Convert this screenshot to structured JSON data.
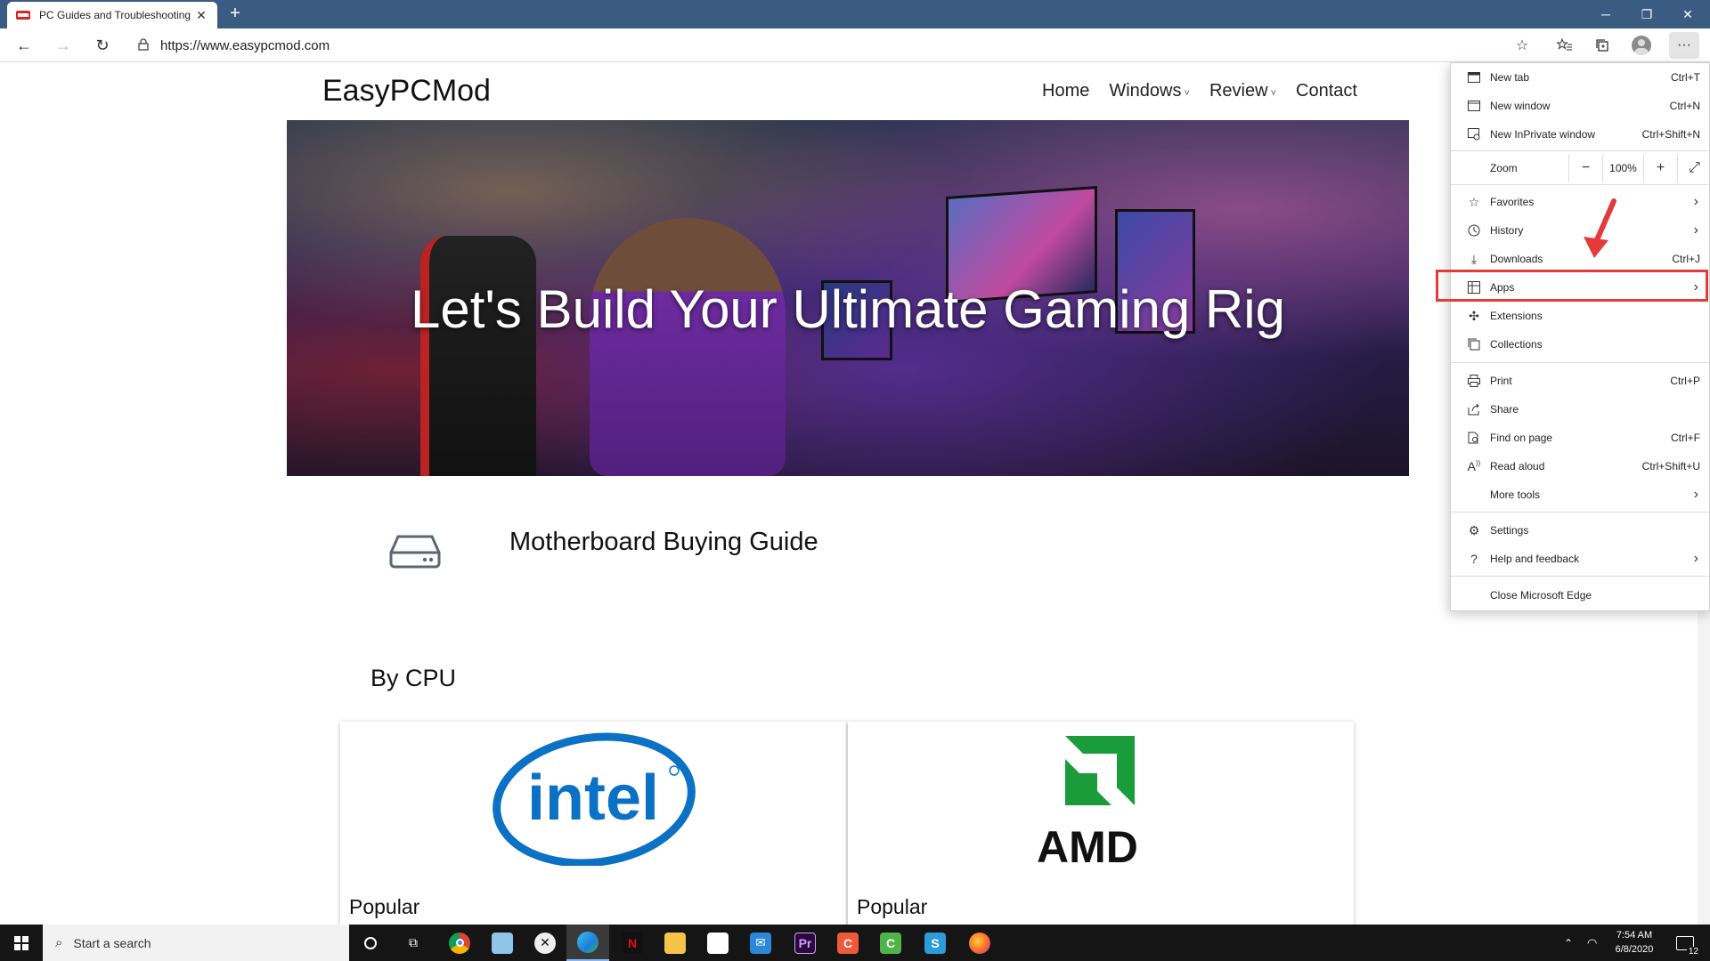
{
  "browser": {
    "tab_title": "PC Guides and Troubleshooting",
    "url": "https://www.easypcmod.com"
  },
  "site": {
    "brand": "EasyPCMod",
    "nav": [
      "Home",
      "Windows",
      "Review",
      "Contact"
    ],
    "hero_title": "Let's Build Your Ultimate Gaming Rig",
    "guide_title": "Motherboard Buying Guide",
    "section_title": "By CPU",
    "cards": [
      {
        "label": "Popular",
        "logo": "intel"
      },
      {
        "label": "Popular",
        "logo": "AMD"
      }
    ]
  },
  "menu": {
    "new_tab": "New tab",
    "new_tab_sc": "Ctrl+T",
    "new_window": "New window",
    "new_window_sc": "Ctrl+N",
    "new_inprivate": "New InPrivate window",
    "new_inprivate_sc": "Ctrl+Shift+N",
    "zoom": "Zoom",
    "zoom_value": "100%",
    "favorites": "Favorites",
    "history": "History",
    "downloads": "Downloads",
    "downloads_sc": "Ctrl+J",
    "apps": "Apps",
    "extensions": "Extensions",
    "collections": "Collections",
    "print": "Print",
    "print_sc": "Ctrl+P",
    "share": "Share",
    "find": "Find on page",
    "find_sc": "Ctrl+F",
    "read_aloud": "Read aloud",
    "read_aloud_sc": "Ctrl+Shift+U",
    "more_tools": "More tools",
    "settings": "Settings",
    "help": "Help and feedback",
    "close": "Close Microsoft Edge"
  },
  "taskbar": {
    "search_placeholder": "Start a search",
    "time": "7:54 AM",
    "date": "6/8/2020",
    "notification_count": "12"
  },
  "colors": {
    "titlebar": "#3a5b82",
    "highlight": "#e53a3a",
    "amd_green": "#1b9c3a",
    "intel_blue": "#0b71c5"
  }
}
